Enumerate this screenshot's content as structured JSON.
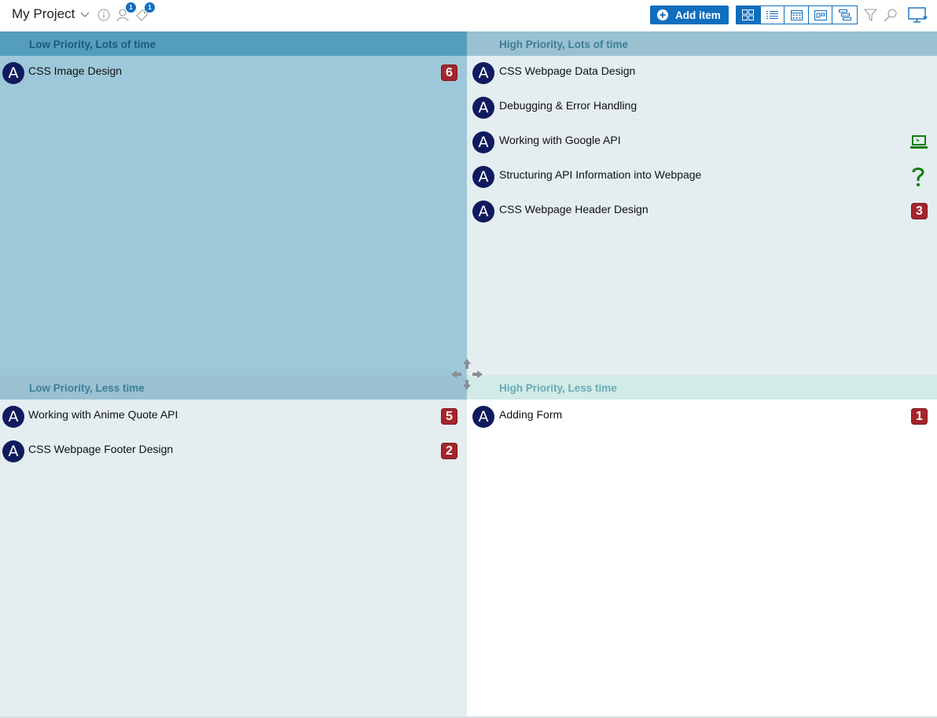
{
  "header": {
    "project_name": "My Project",
    "members_badge": "1",
    "tags_badge": "1",
    "add_item_label": "Add item"
  },
  "colors": {
    "accent": "#106ebe",
    "avatar": "#0f1b5e",
    "priority_badge": "#a4262c",
    "status_green": "#107c10"
  },
  "quadrants": {
    "top_left": {
      "title": "Low Priority, Lots of time",
      "tasks": [
        {
          "avatar": "A",
          "title": "CSS Image Design",
          "badge": "6"
        }
      ]
    },
    "top_right": {
      "title": "High Priority, Lots of time",
      "tasks": [
        {
          "avatar": "A",
          "title": "CSS Webpage Data Design"
        },
        {
          "avatar": "A",
          "title": "Debugging & Error Handling"
        },
        {
          "avatar": "A",
          "title": "Working with Google API",
          "status_icon": "computer-icon"
        },
        {
          "avatar": "A",
          "title": "Structuring API Information into Webpage",
          "status_icon": "question-icon"
        },
        {
          "avatar": "A",
          "title": "CSS Webpage Header Design",
          "badge": "3"
        }
      ]
    },
    "bottom_left": {
      "title": "Low Priority, Less time",
      "tasks": [
        {
          "avatar": "A",
          "title": "Working with Anime Quote API",
          "badge": "5"
        },
        {
          "avatar": "A",
          "title": "CSS Webpage Footer Design",
          "badge": "2"
        }
      ]
    },
    "bottom_right": {
      "title": "High Priority, Less time",
      "tasks": [
        {
          "avatar": "A",
          "title": "Adding Form",
          "badge": "1"
        }
      ]
    }
  }
}
